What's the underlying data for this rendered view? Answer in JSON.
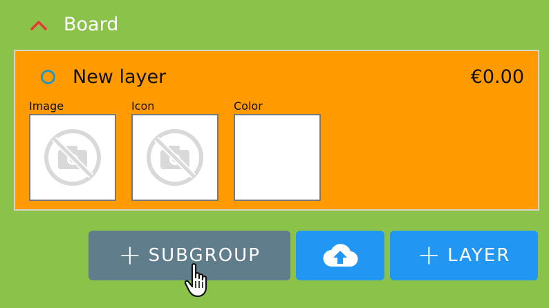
{
  "header": {
    "title": "Board",
    "chevron_icon": "chevron-up-icon",
    "chevron_color": "#e53935"
  },
  "layer": {
    "name": "New layer",
    "price": "€0.00",
    "radio_color": "#2196c8",
    "card_color": "#ff9a00",
    "slots": [
      {
        "label": "Image",
        "placeholder_icon": "no-image-icon"
      },
      {
        "label": "Icon",
        "placeholder_icon": "no-image-icon"
      },
      {
        "label": "Color"
      }
    ]
  },
  "actions": {
    "subgroup_label": "SUBGROUP",
    "upload_icon": "cloud-upload-icon",
    "layer_label": "LAYER",
    "subgroup_color": "#607d8b",
    "primary_color": "#2196f3"
  },
  "cursor_icon": "hand-pointer-icon"
}
